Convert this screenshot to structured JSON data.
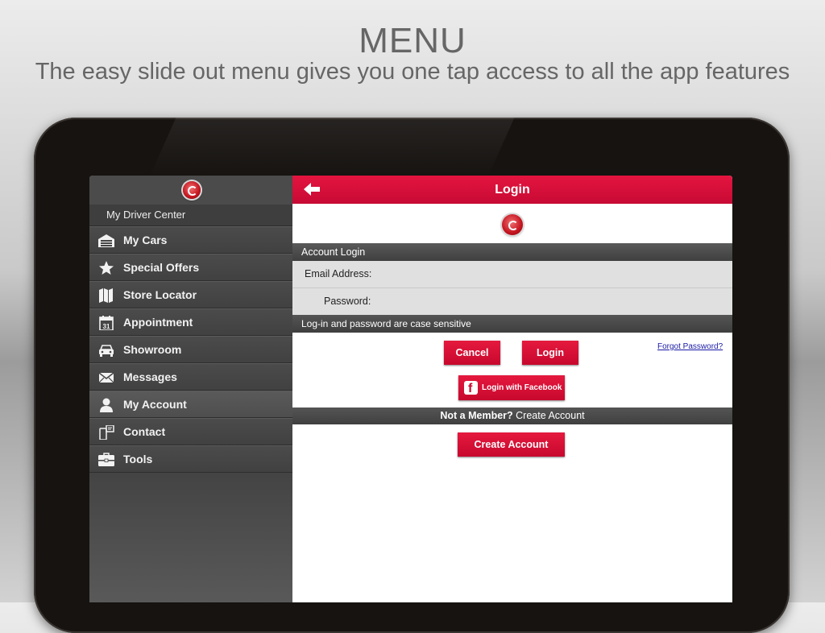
{
  "promo": {
    "title": "MENU",
    "subtitle": "The easy slide out menu gives you one tap access to all the app features"
  },
  "sidebar": {
    "header": "My Driver Center",
    "items": [
      {
        "label": "My Cars",
        "icon": "garage-icon"
      },
      {
        "label": "Special Offers",
        "icon": "star-icon"
      },
      {
        "label": "Store Locator",
        "icon": "map-icon"
      },
      {
        "label": "Appointment",
        "icon": "calendar-icon"
      },
      {
        "label": "Showroom",
        "icon": "car-icon"
      },
      {
        "label": "Messages",
        "icon": "envelope-icon"
      },
      {
        "label": "My Account",
        "icon": "person-icon",
        "active": true
      },
      {
        "label": "Contact",
        "icon": "phone-icon"
      },
      {
        "label": "Tools",
        "icon": "toolbox-icon"
      }
    ],
    "calendar_day": "31"
  },
  "topbar": {
    "title": "Login"
  },
  "login": {
    "section_title": "Account Login",
    "email_label": "Email Address:",
    "email_value": "",
    "password_label": "Password:",
    "password_value": "",
    "note": "Log-in and password are case sensitive",
    "cancel_label": "Cancel",
    "login_label": "Login",
    "forgot_label": "Forgot Password?",
    "facebook_label": "Login with Facebook",
    "not_member": "Not a Member?",
    "create_account_link": "Create Account",
    "create_account_button": "Create Account"
  },
  "colors": {
    "brand_red": "#d90f38",
    "sidebar_bg": "#454545",
    "bar_dark": "#474747"
  }
}
